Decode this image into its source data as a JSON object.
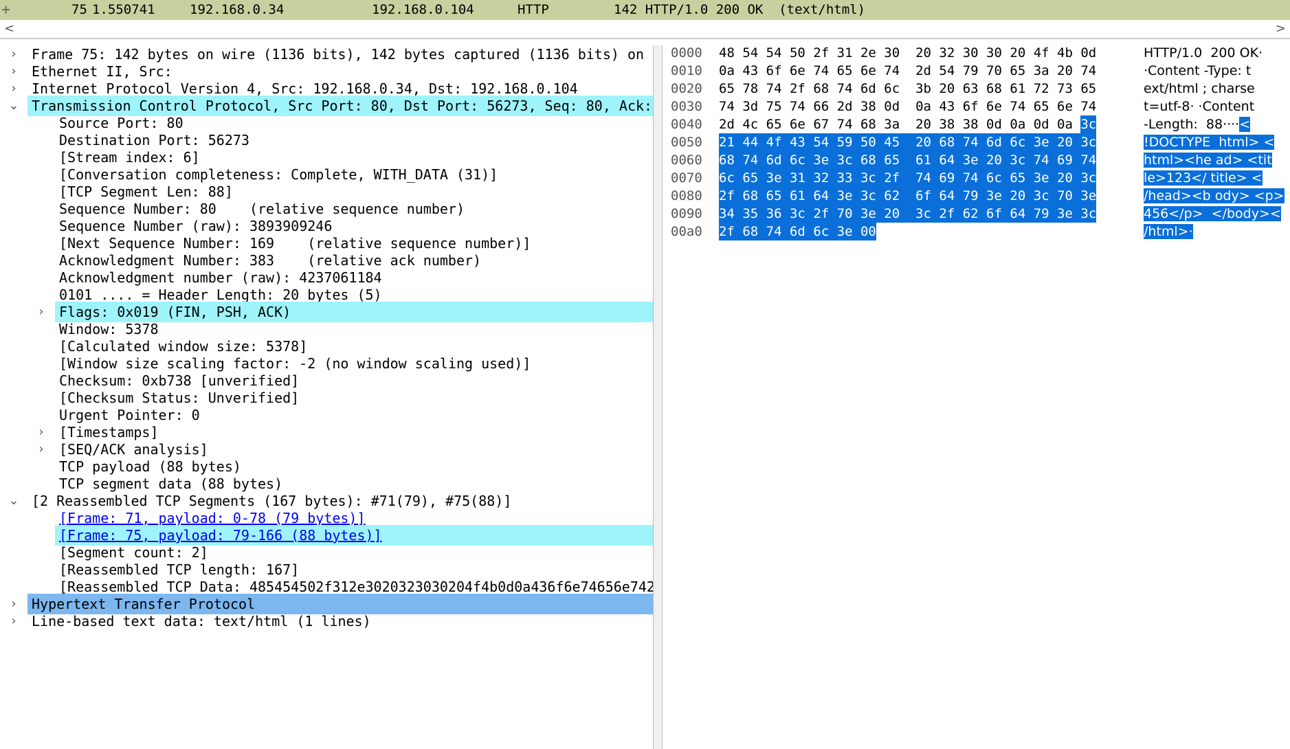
{
  "packet_row": {
    "no": "75",
    "time": "1.550741",
    "source": "192.168.0.34",
    "destination": "192.168.0.104",
    "protocol": "HTTP",
    "info": "142 HTTP/1.0 200 OK  (text/html)"
  },
  "scrollbar": {
    "left_arrow": "<",
    "right_arrow": ">"
  },
  "tree": [
    {
      "text": "Frame 75: 142 bytes on wire (1136 bits), 142 bytes captured (1136 bits) on",
      "level": 0,
      "arrow": "›",
      "highlight": ""
    },
    {
      "text": "Ethernet II, Src: ",
      "level": 0,
      "arrow": "›",
      "highlight": ""
    },
    {
      "text": "Internet Protocol Version 4, Src: 192.168.0.34, Dst: 192.168.0.104",
      "level": 0,
      "arrow": "›",
      "highlight": ""
    },
    {
      "text": "Transmission Control Protocol, Src Port: 80, Dst Port: 56273, Seq: 80, Ack:",
      "level": 0,
      "arrow": "⌄",
      "highlight": "cyan"
    },
    {
      "text": "Source Port: 80",
      "level": 1,
      "arrow": "",
      "highlight": ""
    },
    {
      "text": "Destination Port: 56273",
      "level": 1,
      "arrow": "",
      "highlight": ""
    },
    {
      "text": "[Stream index: 6]",
      "level": 1,
      "arrow": "",
      "highlight": ""
    },
    {
      "text": "[Conversation completeness: Complete, WITH_DATA (31)]",
      "level": 1,
      "arrow": "",
      "highlight": ""
    },
    {
      "text": "[TCP Segment Len: 88]",
      "level": 1,
      "arrow": "",
      "highlight": ""
    },
    {
      "text": "Sequence Number: 80    (relative sequence number)",
      "level": 1,
      "arrow": "",
      "highlight": ""
    },
    {
      "text": "Sequence Number (raw): 3893909246",
      "level": 1,
      "arrow": "",
      "highlight": ""
    },
    {
      "text": "[Next Sequence Number: 169    (relative sequence number)]",
      "level": 1,
      "arrow": "",
      "highlight": ""
    },
    {
      "text": "Acknowledgment Number: 383    (relative ack number)",
      "level": 1,
      "arrow": "",
      "highlight": ""
    },
    {
      "text": "Acknowledgment number (raw): 4237061184",
      "level": 1,
      "arrow": "",
      "highlight": ""
    },
    {
      "text": "0101 .... = Header Length: 20 bytes (5)",
      "level": 1,
      "arrow": "",
      "highlight": ""
    },
    {
      "text": "Flags: 0x019 (FIN, PSH, ACK)",
      "level": 1,
      "arrow": "›",
      "highlight": "cyan"
    },
    {
      "text": "Window: 5378",
      "level": 1,
      "arrow": "",
      "highlight": ""
    },
    {
      "text": "[Calculated window size: 5378]",
      "level": 1,
      "arrow": "",
      "highlight": ""
    },
    {
      "text": "[Window size scaling factor: -2 (no window scaling used)]",
      "level": 1,
      "arrow": "",
      "highlight": ""
    },
    {
      "text": "Checksum: 0xb738 [unverified]",
      "level": 1,
      "arrow": "",
      "highlight": ""
    },
    {
      "text": "[Checksum Status: Unverified]",
      "level": 1,
      "arrow": "",
      "highlight": ""
    },
    {
      "text": "Urgent Pointer: 0",
      "level": 1,
      "arrow": "",
      "highlight": ""
    },
    {
      "text": "[Timestamps]",
      "level": 1,
      "arrow": "›",
      "highlight": ""
    },
    {
      "text": "[SEQ/ACK analysis]",
      "level": 1,
      "arrow": "›",
      "highlight": ""
    },
    {
      "text": "TCP payload (88 bytes)",
      "level": 1,
      "arrow": "",
      "highlight": ""
    },
    {
      "text": "TCP segment data (88 bytes)",
      "level": 1,
      "arrow": "",
      "highlight": ""
    },
    {
      "text": "[2 Reassembled TCP Segments (167 bytes): #71(79), #75(88)]",
      "level": 0,
      "arrow": "⌄",
      "highlight": ""
    },
    {
      "text": "[Frame: 71, payload: 0-78 (79 bytes)]",
      "level": 1,
      "arrow": "",
      "highlight": "",
      "link": true
    },
    {
      "text": "[Frame: 75, payload: 79-166 (88 bytes)]",
      "level": 1,
      "arrow": "",
      "highlight": "cyan",
      "link": true
    },
    {
      "text": "[Segment count: 2]",
      "level": 1,
      "arrow": "",
      "highlight": ""
    },
    {
      "text": "[Reassembled TCP length: 167]",
      "level": 1,
      "arrow": "",
      "highlight": ""
    },
    {
      "text": "[Reassembled TCP Data: 485454502f312e3020323030204f4b0d0a436f6e74656e742",
      "level": 1,
      "arrow": "",
      "highlight": ""
    },
    {
      "text": "Hypertext Transfer Protocol",
      "level": 0,
      "arrow": "›",
      "highlight": "blue"
    },
    {
      "text": "Line-based text data: text/html (1 lines)",
      "level": 0,
      "arrow": "›",
      "highlight": ""
    }
  ],
  "hex": [
    {
      "offset": "0000",
      "bytes": [
        "48",
        "54",
        "54",
        "50",
        "2f",
        "31",
        "2e",
        "30",
        "20",
        "32",
        "30",
        "30",
        "20",
        "4f",
        "4b",
        "0d"
      ],
      "ascii": "HTTP/1.0  200 OK·",
      "sel_from": 16
    },
    {
      "offset": "0010",
      "bytes": [
        "0a",
        "43",
        "6f",
        "6e",
        "74",
        "65",
        "6e",
        "74",
        "2d",
        "54",
        "79",
        "70",
        "65",
        "3a",
        "20",
        "74"
      ],
      "ascii": "·Content -Type: t",
      "sel_from": 16
    },
    {
      "offset": "0020",
      "bytes": [
        "65",
        "78",
        "74",
        "2f",
        "68",
        "74",
        "6d",
        "6c",
        "3b",
        "20",
        "63",
        "68",
        "61",
        "72",
        "73",
        "65"
      ],
      "ascii": "ext/html ; charse",
      "sel_from": 16
    },
    {
      "offset": "0030",
      "bytes": [
        "74",
        "3d",
        "75",
        "74",
        "66",
        "2d",
        "38",
        "0d",
        "0a",
        "43",
        "6f",
        "6e",
        "74",
        "65",
        "6e",
        "74"
      ],
      "ascii": "t=utf-8· ·Content",
      "sel_from": 16
    },
    {
      "offset": "0040",
      "bytes": [
        "2d",
        "4c",
        "65",
        "6e",
        "67",
        "74",
        "68",
        "3a",
        "20",
        "38",
        "38",
        "0d",
        "0a",
        "0d",
        "0a",
        "3c"
      ],
      "ascii": "-Length:  88····<",
      "sel_from": 15
    },
    {
      "offset": "0050",
      "bytes": [
        "21",
        "44",
        "4f",
        "43",
        "54",
        "59",
        "50",
        "45",
        "20",
        "68",
        "74",
        "6d",
        "6c",
        "3e",
        "20",
        "3c"
      ],
      "ascii": "!DOCTYPE  html> <",
      "sel_from": 0
    },
    {
      "offset": "0060",
      "bytes": [
        "68",
        "74",
        "6d",
        "6c",
        "3e",
        "3c",
        "68",
        "65",
        "61",
        "64",
        "3e",
        "20",
        "3c",
        "74",
        "69",
        "74"
      ],
      "ascii": "html><he ad> <tit",
      "sel_from": 0
    },
    {
      "offset": "0070",
      "bytes": [
        "6c",
        "65",
        "3e",
        "31",
        "32",
        "33",
        "3c",
        "2f",
        "74",
        "69",
        "74",
        "6c",
        "65",
        "3e",
        "20",
        "3c"
      ],
      "ascii": "le>123</ title> <",
      "sel_from": 0
    },
    {
      "offset": "0080",
      "bytes": [
        "2f",
        "68",
        "65",
        "61",
        "64",
        "3e",
        "3c",
        "62",
        "6f",
        "64",
        "79",
        "3e",
        "20",
        "3c",
        "70",
        "3e"
      ],
      "ascii": "/head><b ody> <p>",
      "sel_from": 0
    },
    {
      "offset": "0090",
      "bytes": [
        "34",
        "35",
        "36",
        "3c",
        "2f",
        "70",
        "3e",
        "20",
        "3c",
        "2f",
        "62",
        "6f",
        "64",
        "79",
        "3e",
        "3c"
      ],
      "ascii": "456</p>  </body><",
      "sel_from": 0
    },
    {
      "offset": "00a0",
      "bytes": [
        "2f",
        "68",
        "74",
        "6d",
        "6c",
        "3e",
        "00"
      ],
      "ascii": "/html>·",
      "sel_from": 0
    }
  ]
}
